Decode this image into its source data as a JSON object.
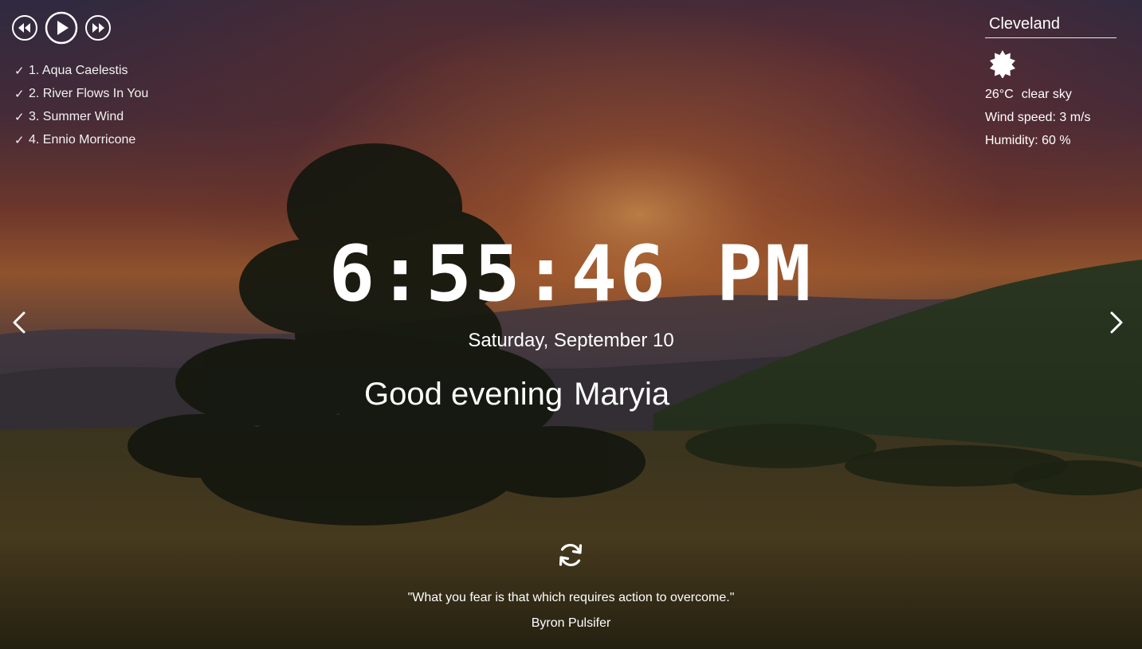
{
  "player": {
    "prev_icon": "rewind-icon",
    "play_icon": "play-icon",
    "next_icon": "fast-forward-icon",
    "tracks": [
      {
        "check": "✓",
        "label": "1. Aqua Caelestis"
      },
      {
        "check": "✓",
        "label": "2. River Flows In You"
      },
      {
        "check": "✓",
        "label": "3. Summer Wind"
      },
      {
        "check": "✓",
        "label": "4. Ennio Morricone"
      }
    ]
  },
  "weather": {
    "city": "Cleveland",
    "icon": "sun-icon",
    "temperature": "26°C",
    "description": "clear sky",
    "wind": "Wind speed: 3 m/s",
    "humidity": "Humidity: 60 %"
  },
  "clock": {
    "time": "6:55:46 PM",
    "date": "Saturday, September 10"
  },
  "greeting": {
    "text": "Good evening",
    "name": "Maryia"
  },
  "slider": {
    "prev_icon": "chevron-left-icon",
    "next_icon": "chevron-right-icon"
  },
  "quote": {
    "refresh_icon": "refresh-icon",
    "text": "\"What you fear is that which requires action to overcome.\"",
    "author": "Byron Pulsifer"
  },
  "colors": {
    "text": "#ffffff",
    "sky_top": "#3a3550",
    "sunset": "#c0582a",
    "field": "#3b3a1c"
  }
}
